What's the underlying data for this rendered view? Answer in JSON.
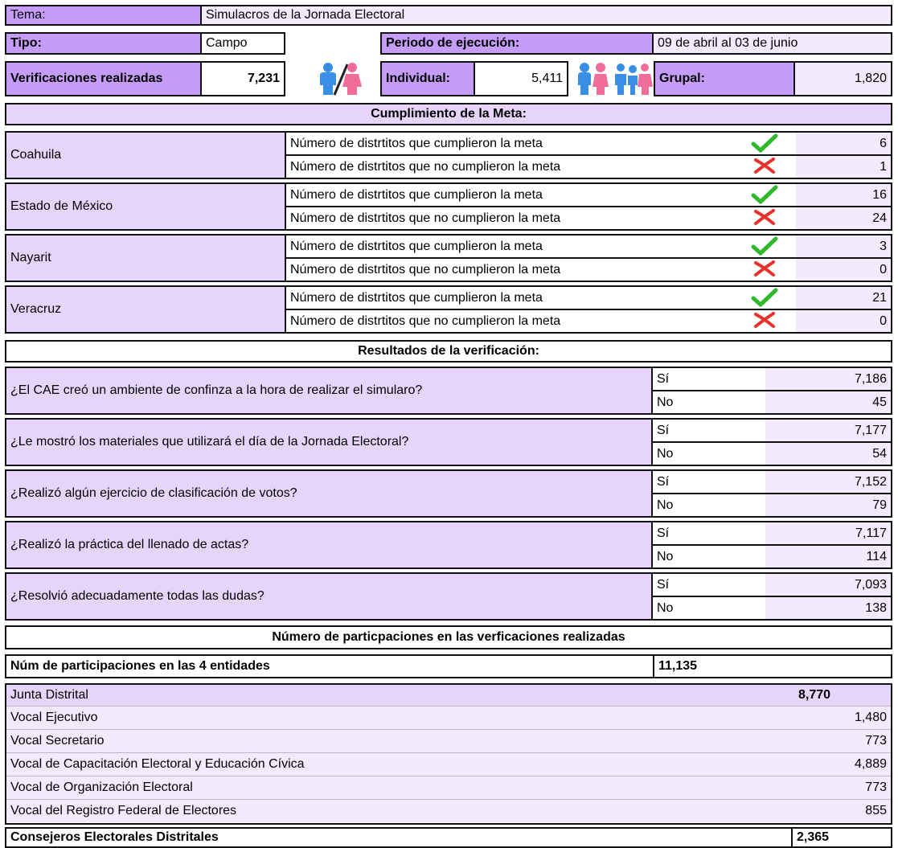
{
  "header": {
    "tema_label": "Tema:",
    "tema_value": "Simulacros de la Jornada Electoral",
    "tipo_label": "Tipo:",
    "tipo_value": "Campo",
    "periodo_label": "Periodo de ejecución:",
    "periodo_value": "09 de abril al 03 de junio",
    "verif_label": "Verificaciones realizadas",
    "verif_value": "7,231",
    "individual_label": "Individual:",
    "individual_value": "5,411",
    "grupal_label": "Grupal:",
    "grupal_value": "1,820"
  },
  "meta": {
    "title": "Cumplimiento de la Meta:",
    "met_label": "Número de distrtitos que cumplieron la meta",
    "notmet_label": "Número de distrtitos que no cumplieron la meta",
    "states": [
      {
        "name": "Coahuila",
        "met": "6",
        "notmet": "1"
      },
      {
        "name": "Estado de México",
        "met": "16",
        "notmet": "24"
      },
      {
        "name": "Nayarit",
        "met": "3",
        "notmet": "0"
      },
      {
        "name": "Veracruz",
        "met": "21",
        "notmet": "0"
      }
    ],
    "colors": {
      "check": "#2fb82a",
      "cross": "#e8312a"
    }
  },
  "results": {
    "title": "Resultados de la verificación:",
    "yes_label": "Sí",
    "no_label": "No",
    "questions": [
      {
        "text": "¿El CAE creó un ambiente de confinza a la hora de realizar el simularo?",
        "si": "7,186",
        "no": "45"
      },
      {
        "text": "¿Le mostró los materiales que utilizará el día de la Jornada Electoral?",
        "si": "7,177",
        "no": "54"
      },
      {
        "text": "¿Realizó algún ejercicio de clasificación de votos?",
        "si": "7,152",
        "no": "79"
      },
      {
        "text": "¿Realizó la práctica del llenado de actas?",
        "si": "7,117",
        "no": "114"
      },
      {
        "text": "¿Resolvió adecuadamente todas las dudas?",
        "si": "7,093",
        "no": "138"
      }
    ]
  },
  "participation": {
    "title": "Número de particpaciones en las verficaciones realizadas",
    "total_label": "Núm de participaciones en las 4 entidades",
    "total_value": "11,135",
    "junta_label": "Junta Distrital",
    "junta_value": "8,770",
    "vocales": [
      {
        "label": "Vocal Ejecutivo",
        "value": "1,480"
      },
      {
        "label": "Vocal Secretario",
        "value": "773"
      },
      {
        "label": "Vocal de Capacitación Electoral y Educación Cívica",
        "value": "4,889"
      },
      {
        "label": "Vocal de Organización Electoral",
        "value": "773"
      },
      {
        "label": "Vocal del Registro Federal de Electores",
        "value": "855"
      }
    ],
    "consejeros_label": "Consejeros Electorales Distritales",
    "consejeros_value": "2,365"
  },
  "icons": {
    "pair": "man-woman-icon",
    "individual": "individual-person-icon",
    "group": "group-people-icon",
    "male_color": "#3a8ee6",
    "female_color": "#f06c9b"
  }
}
